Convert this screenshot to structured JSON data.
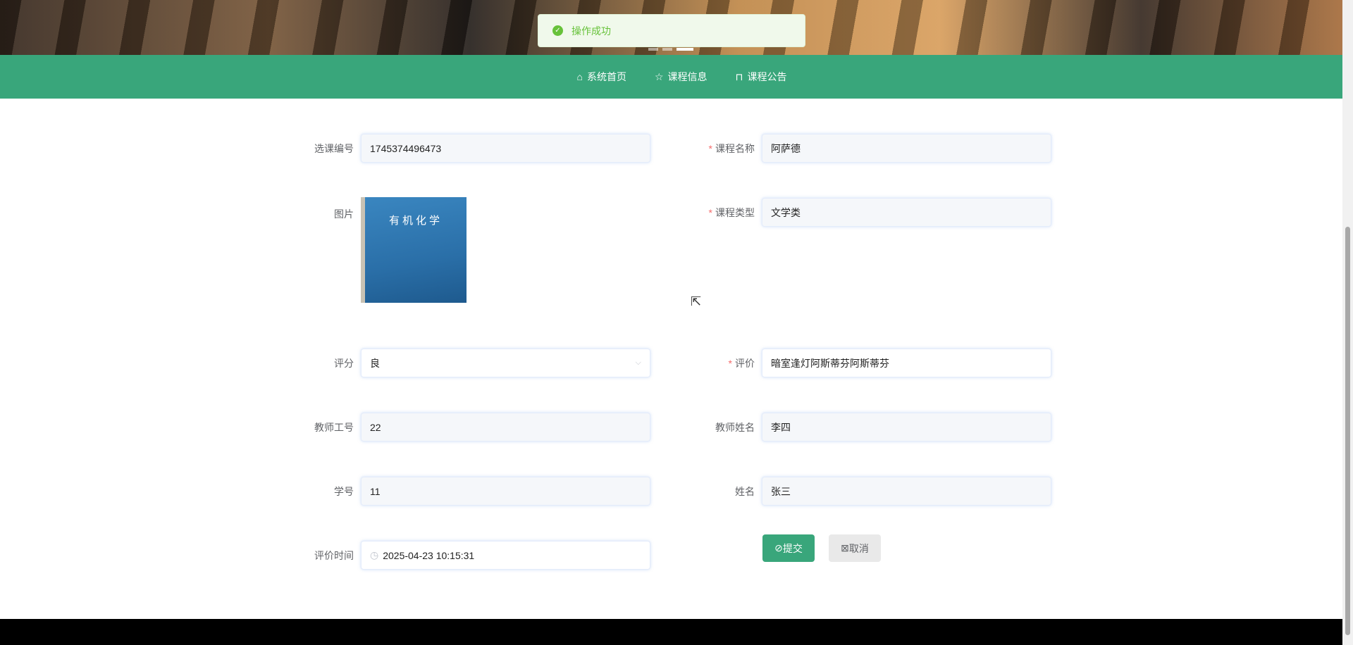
{
  "toast": {
    "message": "操作成功",
    "icon": "check-circle-icon"
  },
  "nav": [
    {
      "label": "系统首页",
      "icon": "home-icon"
    },
    {
      "label": "课程信息",
      "icon": "star-icon"
    },
    {
      "label": "课程公告",
      "icon": "bag-icon"
    }
  ],
  "form": {
    "xuankebianhao": {
      "label": "选课编号",
      "value": "1745374496473"
    },
    "kechengmingcheng": {
      "label": "课程名称",
      "value": "阿萨德",
      "required": true
    },
    "tupian": {
      "label": "图片",
      "image_text": "有机化学"
    },
    "kechengleixing": {
      "label": "课程类型",
      "value": "文学类",
      "required": true
    },
    "pingfen": {
      "label": "评分",
      "value": "良"
    },
    "pingjia": {
      "label": "评价",
      "value": "暗室逢灯阿斯蒂芬阿斯蒂芬",
      "required": true
    },
    "jiaoshigonghao": {
      "label": "教师工号",
      "value": "22"
    },
    "jiaoshixingming": {
      "label": "教师姓名",
      "value": "李四"
    },
    "xuehao": {
      "label": "学号",
      "value": "11"
    },
    "xingming": {
      "label": "姓名",
      "value": "张三"
    },
    "pingjiashijian": {
      "label": "评价时间",
      "value": "2025-04-23 10:15:31"
    }
  },
  "buttons": {
    "submit": "提交",
    "cancel": "取消"
  },
  "required_mark": "*"
}
